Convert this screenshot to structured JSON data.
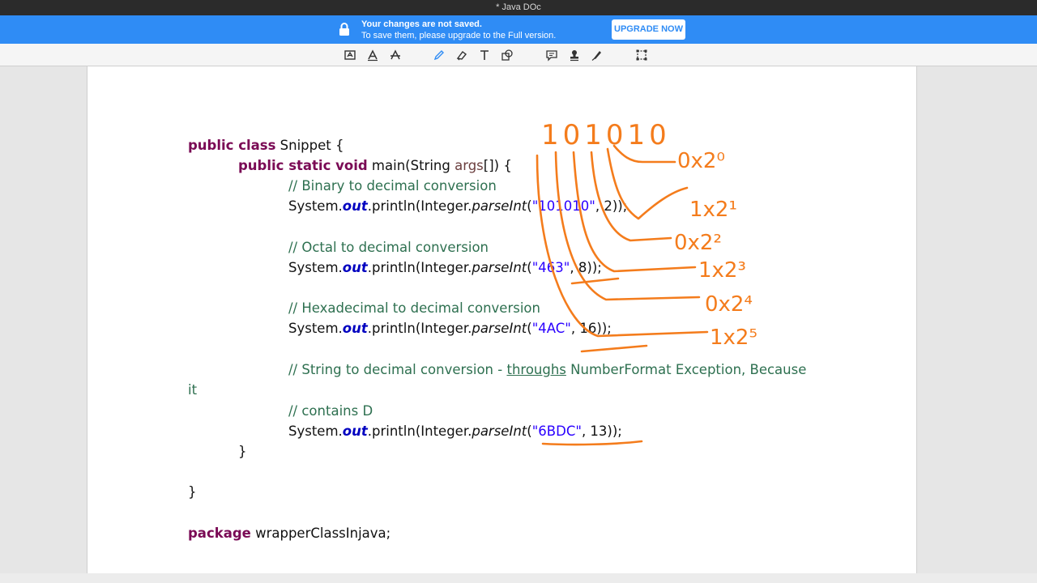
{
  "window": {
    "title": "* Java DOc"
  },
  "banner": {
    "line1": "Your changes are not saved.",
    "line2": "To save them, please upgrade to the Full version.",
    "upgrade_label": "UPGRADE NOW"
  },
  "toolbar": {
    "tools": [
      "text-edit-icon",
      "text-icon",
      "strikethrough-text-icon",
      "pencil-icon",
      "eraser-icon",
      "add-text-icon",
      "shapes-icon",
      "comment-icon",
      "stamp-icon",
      "signature-pen-icon",
      "crop-icon"
    ]
  },
  "code": {
    "l1_kw": "public class",
    "l1_rest": " Snippet {",
    "l2_kw": "public static void",
    "l2_rest1": " main(String ",
    "l2_var": "args",
    "l2_rest2": "[]) {",
    "c1": "// Binary to decimal conversion",
    "p_prefix": "System.",
    "p_out": "out",
    "p_mid": ".println(Integer.",
    "p_parse": "parseInt",
    "p_open": "(",
    "s1": "\"101010\"",
    "r1": ", 2));",
    "c2": "// Octal to decimal conversion",
    "s2": "\"463\"",
    "r2": ", 8));",
    "c3": "// Hexadecimal to decimal conversion",
    "s3": "\"4AC\"",
    "r3": ", 16));",
    "c4a": "// String to decimal conversion - ",
    "c4b": "throughs",
    "c4c": " NumberFormat Exception, Because",
    "c4d": "it",
    "c5": "// contains D",
    "s4": "\"6BDC\"",
    "r4": ", 13));",
    "close1": "}",
    "close2": "}",
    "pkg_kw": "package",
    "pkg_rest": " wrapperClassInjava;"
  },
  "annotations": {
    "color": "#f47c1c",
    "digits": "101010",
    "terms": [
      "0x2⁰",
      "1x2¹",
      "0x2²",
      "1x2³",
      "0x2⁴",
      "1x2⁵"
    ]
  }
}
